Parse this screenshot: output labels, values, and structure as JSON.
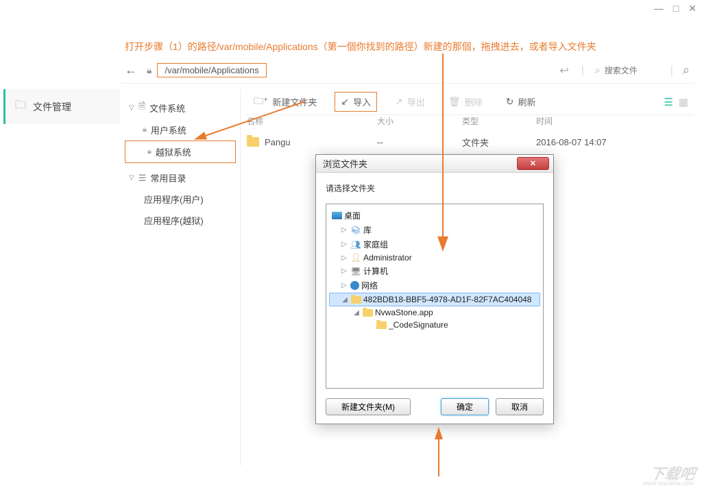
{
  "window": {
    "min": "—",
    "max": "□",
    "close": "✕"
  },
  "instruction": "打开步骤（1）的路径/var/mobile/Applications（第一個你找到的路徑）新建的那個，拖拽进去，或者导入文件夹",
  "pathBar": {
    "path": "/var/mobile/Applications",
    "searchPlaceholder": "搜索文件"
  },
  "sidebar": {
    "fileManager": "文件管理"
  },
  "tree": {
    "fileSystemHeader": "文件系统",
    "userSystem": "用户系统",
    "jailbreakSystem": "越狱系统",
    "commonDirsHeader": "常用目录",
    "appsUser": "应用程序(用户)",
    "appsJailbreak": "应用程序(越狱)"
  },
  "toolbar": {
    "newFolder": "新建文件夹",
    "import": "导入",
    "export": "导出",
    "delete": "删除",
    "refresh": "刷新"
  },
  "fileList": {
    "headers": {
      "name": "名称",
      "size": "大小",
      "type": "类型",
      "time": "时间"
    },
    "rows": [
      {
        "name": "Pangu",
        "size": "--",
        "type": "文件夹",
        "time": "2016-08-07 14:07"
      }
    ]
  },
  "dialog": {
    "title": "浏览文件夹",
    "prompt": "请选择文件夹",
    "tree": {
      "desktop": "桌面",
      "library": "库",
      "homegroup": "家庭组",
      "administrator": "Administrator",
      "computer": "计算机",
      "network": "网络",
      "selectedFolder": "482BDB18-BBF5-4978-AD1F-82F7AC404048",
      "app": "NvwaStone.app",
      "codeSignature": "_CodeSignature"
    },
    "buttons": {
      "newFolder": "新建文件夹(M)",
      "ok": "确定",
      "cancel": "取消"
    }
  },
  "watermark": {
    "main": "下载吧",
    "sub": "www.xiazaiba.com"
  }
}
